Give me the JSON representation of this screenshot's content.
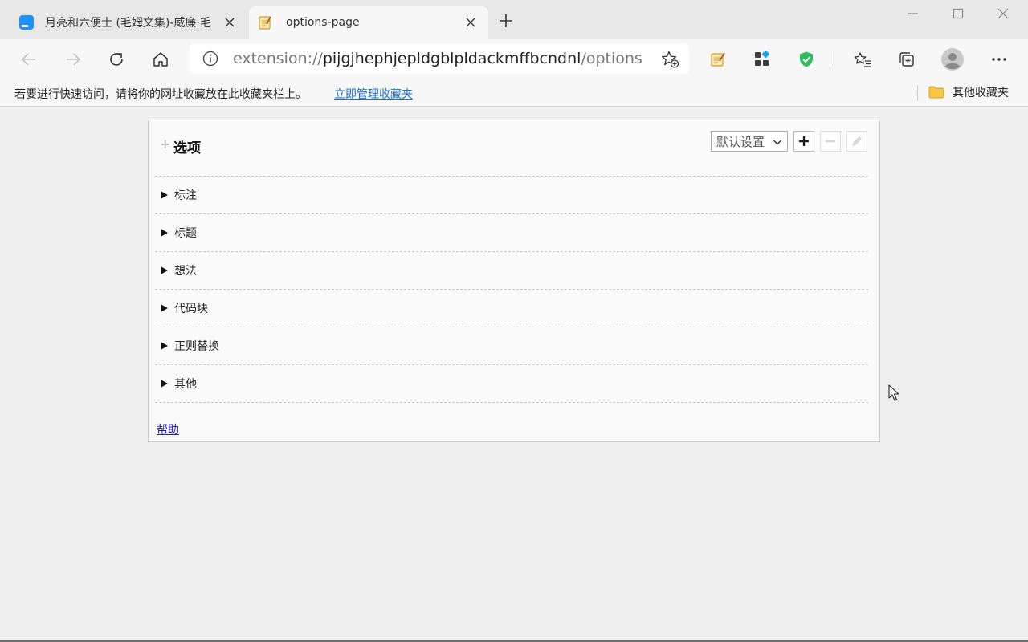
{
  "browser": {
    "tabs": [
      {
        "title": "月亮和六便士 (毛姆文集)-威廉·毛",
        "favicon": "reader-app-icon",
        "active": false
      },
      {
        "title": "options-page",
        "favicon": "notepad-icon",
        "active": true
      }
    ],
    "address": {
      "scheme": "extension://",
      "host": "pijgjhephjepldgblpldackmffbcndnl",
      "path": "/options/..."
    },
    "favorites_bar": {
      "message": "若要进行快速访问，请将你的网址收藏放在此收藏夹栏上。",
      "manage_link": "立即管理收藏夹",
      "other_favorites": "其他收藏夹"
    }
  },
  "options": {
    "title": "选项",
    "preset_selected": "默认设置",
    "sections": [
      {
        "label": "标注"
      },
      {
        "label": "标题"
      },
      {
        "label": "想法"
      },
      {
        "label": "代码块"
      },
      {
        "label": "正则替换"
      },
      {
        "label": "其他"
      }
    ],
    "help_link": "帮助"
  }
}
